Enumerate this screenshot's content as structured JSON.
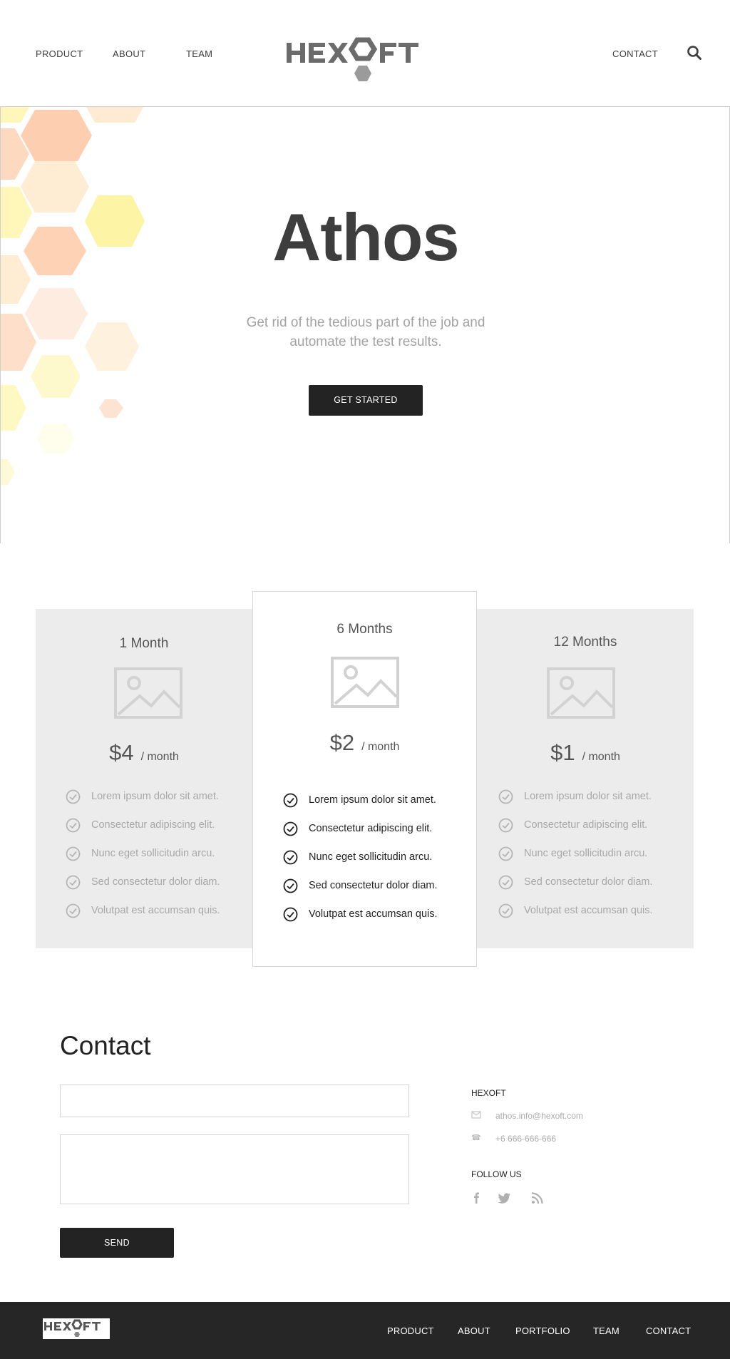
{
  "header": {
    "nav_left": [
      "PRODUCT",
      "ABOUT",
      "TEAM"
    ],
    "nav_right": [
      "CONTACT"
    ],
    "logo_text": "HEXOFT",
    "search_icon": "search-icon"
  },
  "hero": {
    "title": "Athos",
    "subtitle": "Get rid of the tedious part of the job and automate the test results.",
    "cta_label": "GET STARTED"
  },
  "pricing": {
    "plans": [
      {
        "name": "1 Month",
        "price": "$4",
        "period": "/ month",
        "featured": false
      },
      {
        "name": "6 Months",
        "price": "$2",
        "period": "/ month",
        "featured": true
      },
      {
        "name": "12 Months",
        "price": "$1",
        "period": "/ month",
        "featured": false
      }
    ],
    "features": [
      "Lorem ipsum dolor sit amet.",
      "Consectetur adipiscing elit.",
      "Nunc eget sollicitudin arcu.",
      "Sed consectetur dolor diam.",
      "Volutpat est accumsan quis."
    ]
  },
  "contact": {
    "title": "Contact",
    "name_field_value": "",
    "message_field_value": "",
    "send_label": "SEND",
    "company_label": "HEXOFT",
    "email": "athos.info@hexoft.com",
    "phone": "+6 666-666-666",
    "follow_label": "FOLLOW US",
    "social_icons": [
      "facebook-icon",
      "twitter-icon",
      "rss-icon"
    ]
  },
  "footer": {
    "logo_text": "HEXOFT",
    "links": [
      "PRODUCT",
      "ABOUT",
      "PORTFOLIO",
      "TEAM",
      "CONTACT"
    ]
  },
  "colors": {
    "dark": "#232323",
    "text": "#3e3e3e",
    "muted": "#a3a3a3",
    "plan_bg": "#ececec",
    "logo_gray": "#6b6b6b",
    "hex_orange": "#fcbf95",
    "hex_yellow": "#fdf39b"
  }
}
